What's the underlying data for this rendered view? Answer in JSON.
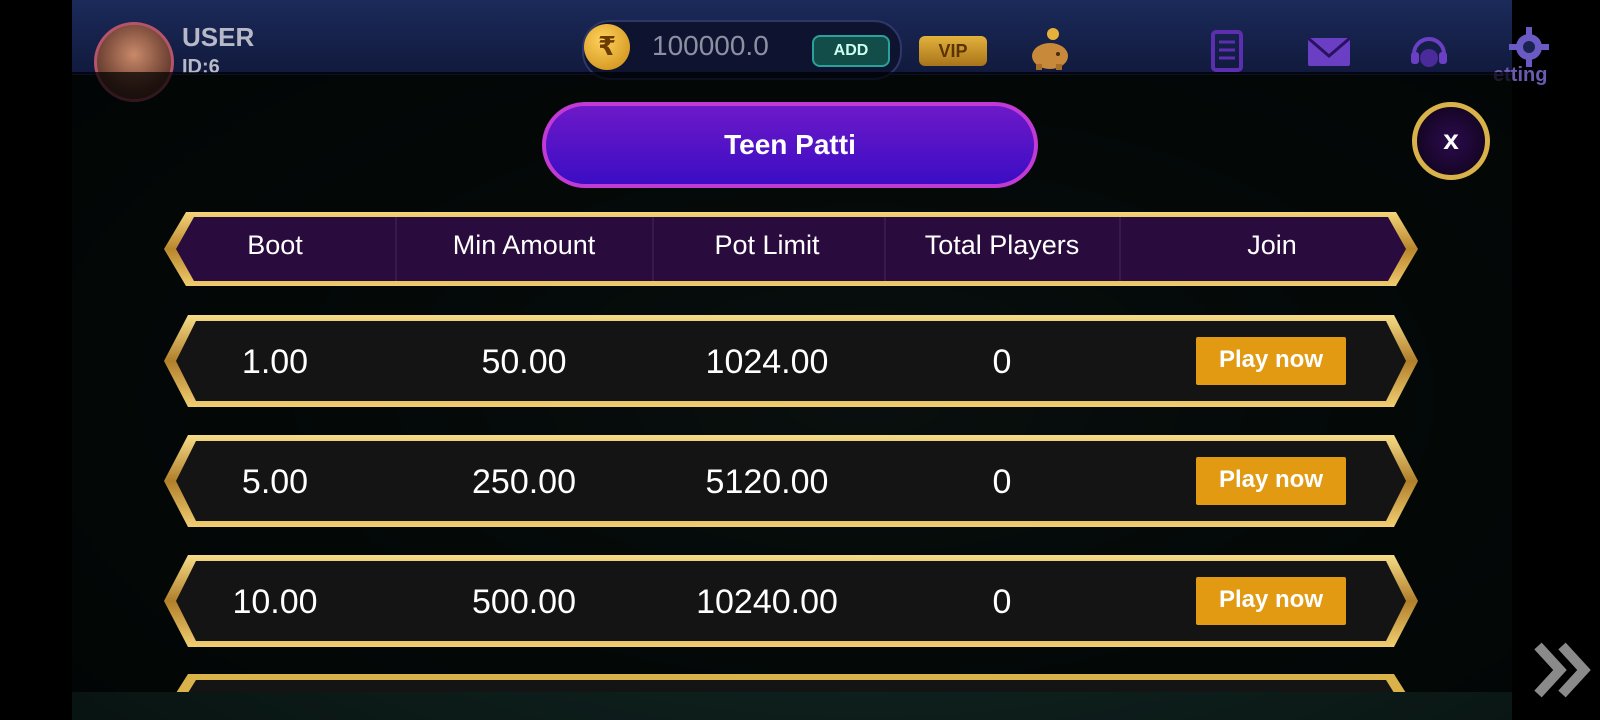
{
  "user": {
    "name": "USER",
    "id": "ID:6"
  },
  "wallet": {
    "currency_icon": "rupee-icon",
    "symbol": "₹",
    "balance": "100000.0",
    "add_label": "ADD"
  },
  "vip": {
    "label": "VIP"
  },
  "top_icons": [
    "piggy-bank-icon",
    "history-scroll-icon",
    "mail-icon",
    "support-headset-icon",
    "gear-icon"
  ],
  "setting_label": "etting",
  "modal": {
    "title": "Teen Patti",
    "close_label": "x",
    "columns": [
      "Boot",
      "Min Amount",
      "Pot Limit",
      "Total Players",
      "Join"
    ],
    "rows": [
      {
        "boot": "1.00",
        "min_amount": "50.00",
        "pot_limit": "1024.00",
        "total_players": "0",
        "join_label": "Play now"
      },
      {
        "boot": "5.00",
        "min_amount": "250.00",
        "pot_limit": "5120.00",
        "total_players": "0",
        "join_label": "Play now"
      },
      {
        "boot": "10.00",
        "min_amount": "500.00",
        "pot_limit": "10240.00",
        "total_players": "0",
        "join_label": "Play now"
      }
    ]
  },
  "colors": {
    "gold": "#d9b24a",
    "play_button": "#e29a12",
    "title_purple": "#4a10c4",
    "header_purple": "#2a0b3d"
  }
}
